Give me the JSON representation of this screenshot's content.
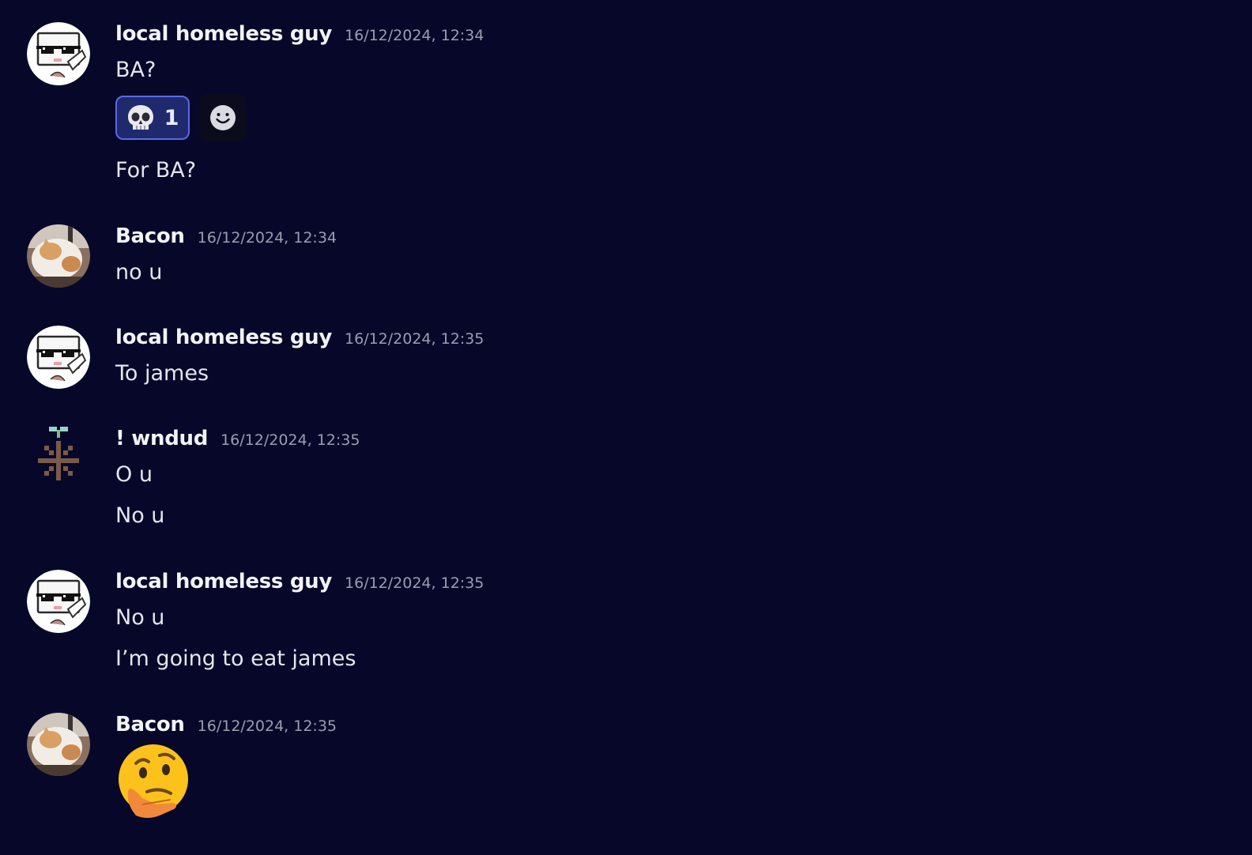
{
  "messages": [
    {
      "username": "local homeless guy",
      "timestamp": "16/12/2024, 12:34",
      "lines": [
        "BA?",
        "For BA?"
      ],
      "reaction": {
        "emoji": "skull-icon",
        "count": "1"
      }
    },
    {
      "username": "Bacon",
      "timestamp": "16/12/2024, 12:34",
      "lines": [
        "no u"
      ]
    },
    {
      "username": "local homeless guy",
      "timestamp": "16/12/2024, 12:35",
      "lines": [
        "To james"
      ]
    },
    {
      "username": "! wndud",
      "timestamp": "16/12/2024, 12:35",
      "lines": [
        "O u",
        "No u"
      ]
    },
    {
      "username": "local homeless guy",
      "timestamp": "16/12/2024, 12:35",
      "lines": [
        "No u",
        "I’m going to eat james"
      ]
    },
    {
      "username": "Bacon",
      "timestamp": "16/12/2024, 12:35",
      "emoji": "thinking-face-icon"
    }
  ],
  "colors": {
    "background": "#070829",
    "reaction_border": "#5a68e6",
    "reaction_bg": "#1f2a6e"
  }
}
